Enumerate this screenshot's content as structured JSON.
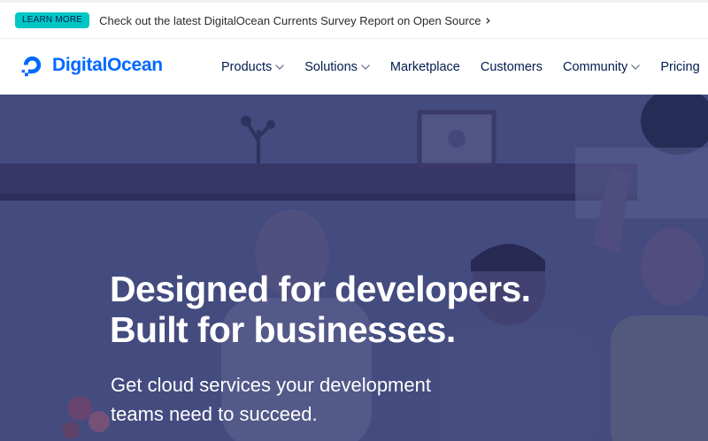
{
  "banner": {
    "badge_label": "LEARN MORE",
    "message": "Check out the latest DigitalOcean Currents Survey Report on Open Source",
    "chevron_icon": "chevron-right-icon"
  },
  "nav": {
    "logo_text": "DigitalOcean",
    "logo_icon": "digitalocean-logo-icon",
    "items": [
      {
        "label": "Products",
        "has_dropdown": true
      },
      {
        "label": "Solutions",
        "has_dropdown": true
      },
      {
        "label": "Marketplace",
        "has_dropdown": false
      },
      {
        "label": "Customers",
        "has_dropdown": false
      },
      {
        "label": "Community",
        "has_dropdown": true
      },
      {
        "label": "Pricing",
        "has_dropdown": false
      }
    ]
  },
  "hero": {
    "title_line1": "Designed for developers.",
    "title_line2": "Built for businesses.",
    "subtitle_line1": "Get cloud services your development",
    "subtitle_line2": "teams need to succeed."
  },
  "colors": {
    "brand_blue": "#0069ff",
    "badge_teal": "#00c6c6",
    "nav_text": "#031b4e",
    "hero_overlay": "#3f4679"
  }
}
